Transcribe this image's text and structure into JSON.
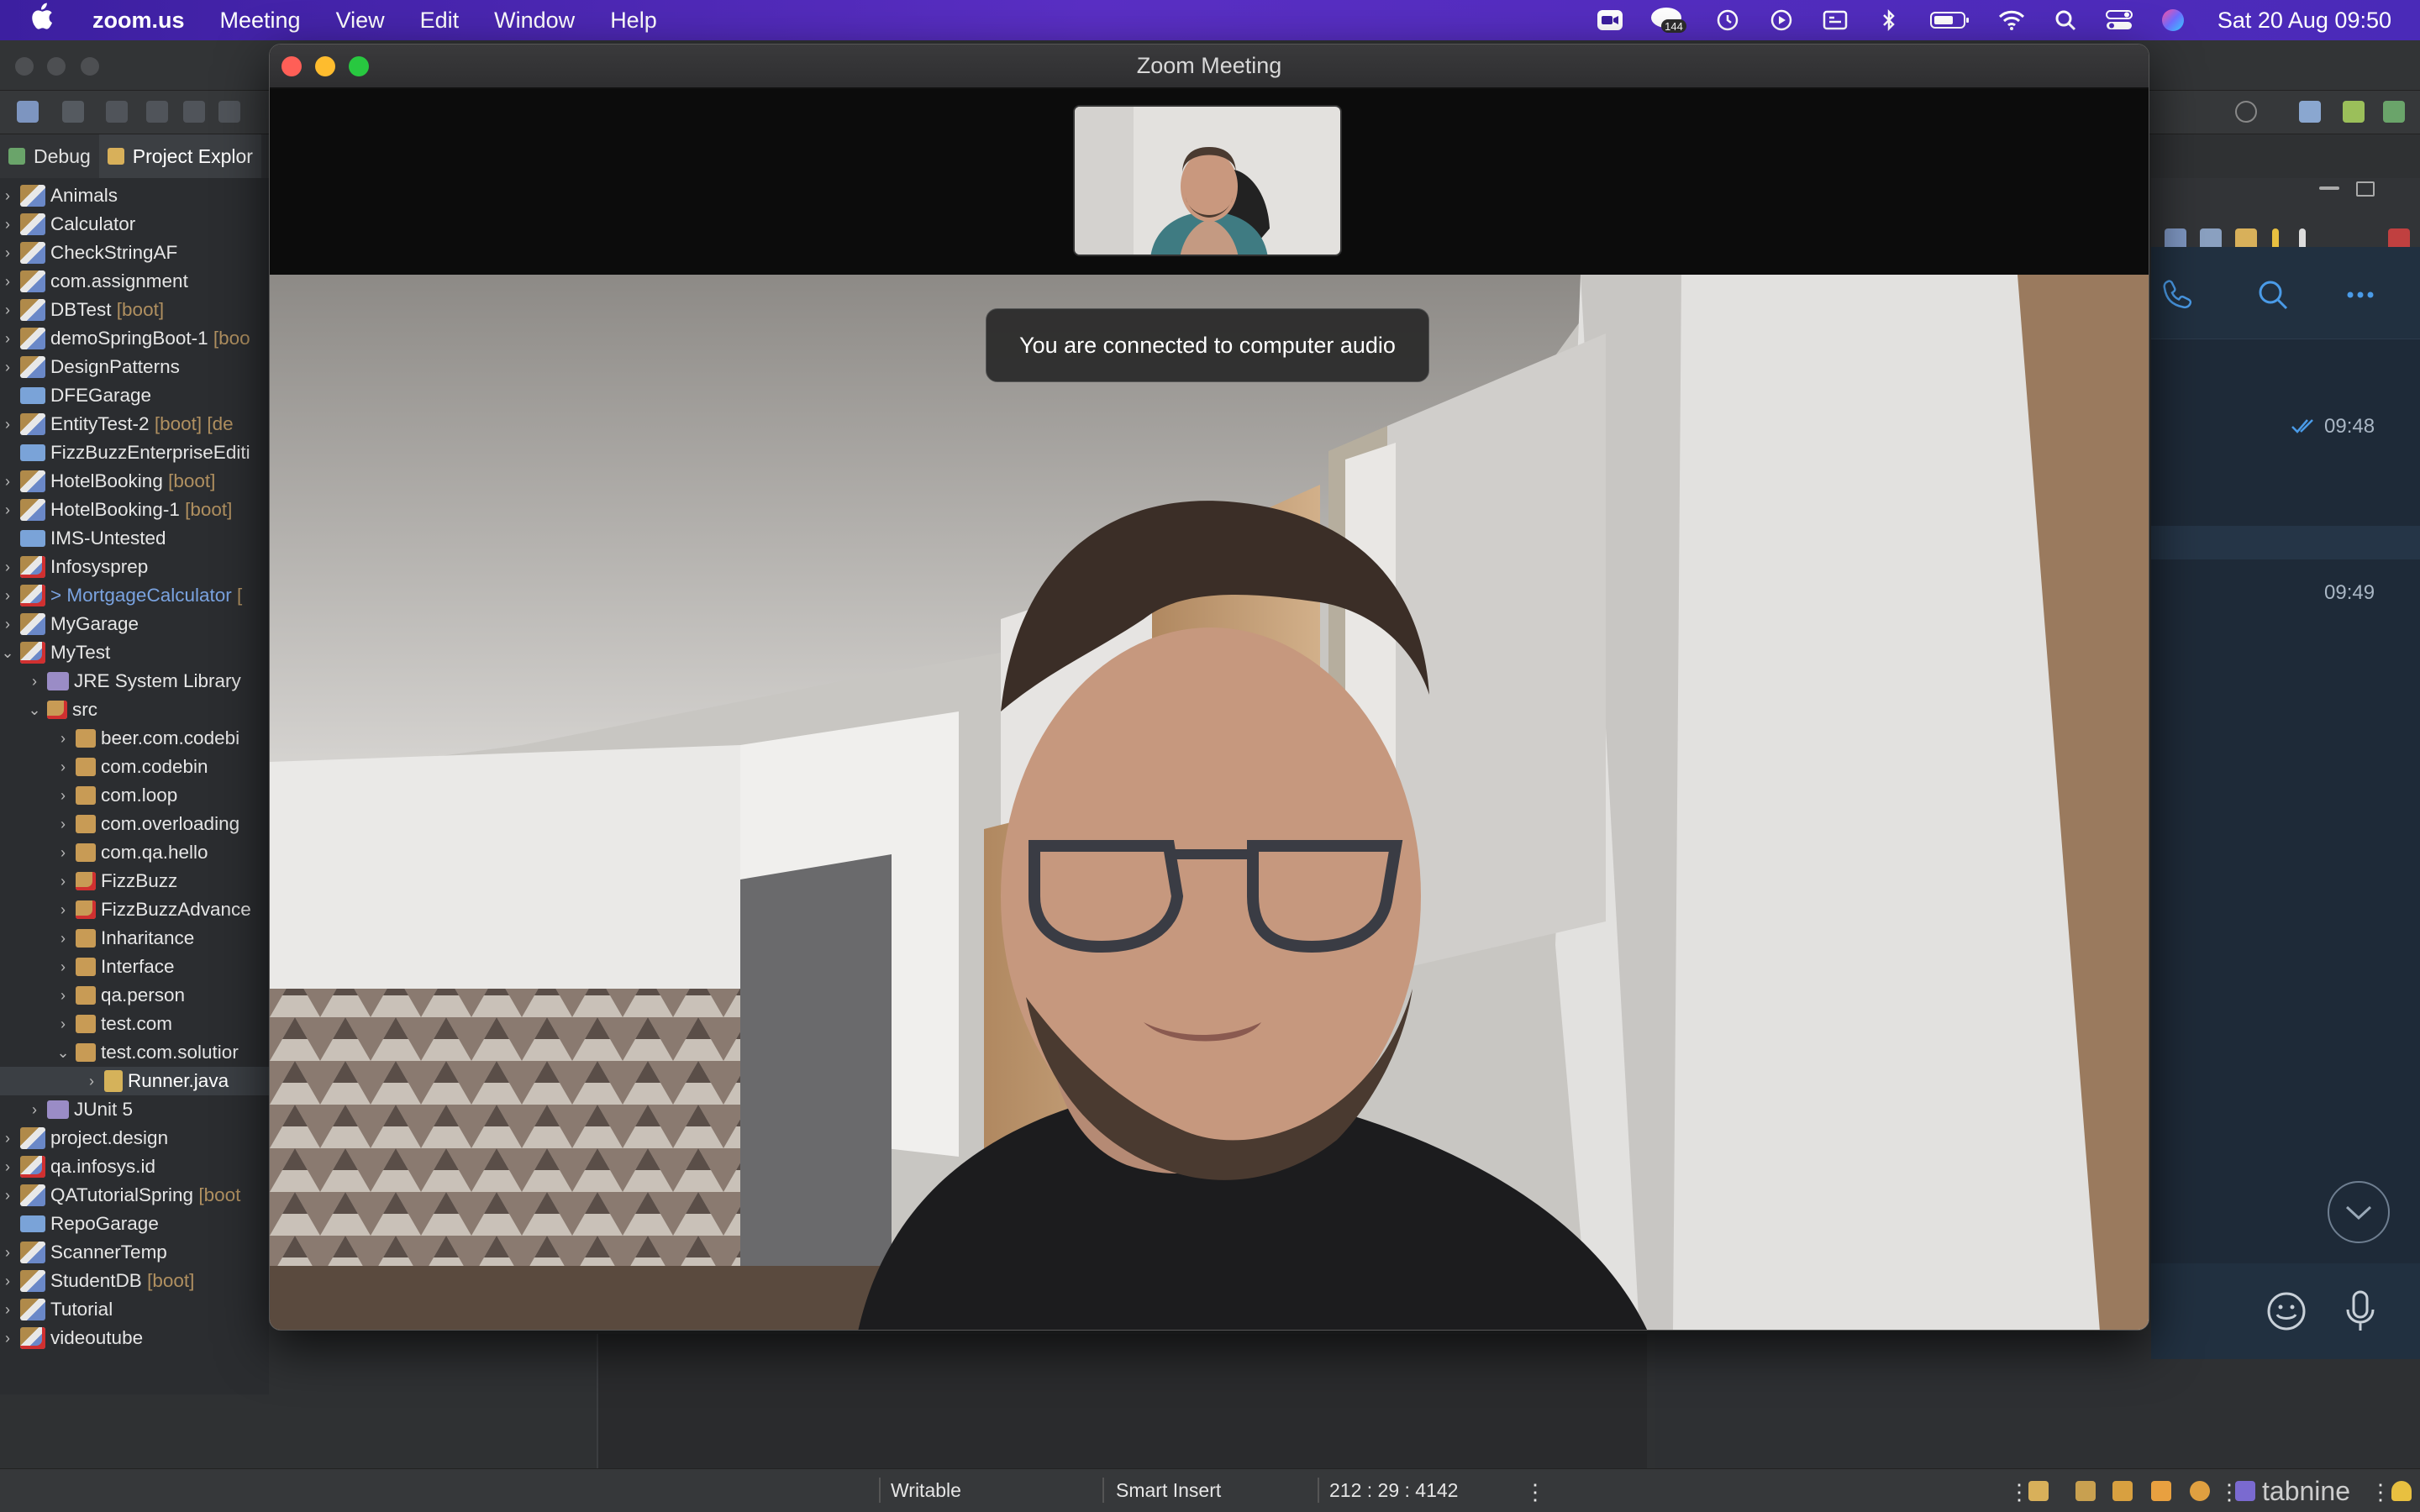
{
  "menubar": {
    "app": "zoom.us",
    "items": [
      "Meeting",
      "View",
      "Edit",
      "Window",
      "Help"
    ],
    "badge_count": "144",
    "datetime": "Sat 20 Aug  09:50"
  },
  "eclipse": {
    "tabs": {
      "debug": "Debug",
      "project_explorer": "Project Explor"
    },
    "tree": [
      {
        "label": "Animals",
        "suffix": ""
      },
      {
        "label": "Calculator",
        "suffix": ""
      },
      {
        "label": "CheckStringAF",
        "suffix": ""
      },
      {
        "label": "com.assignment",
        "suffix": ""
      },
      {
        "label": "DBTest",
        "suffix": "[boot]"
      },
      {
        "label": "demoSpringBoot-1",
        "suffix": "[boo"
      },
      {
        "label": "DesignPatterns",
        "suffix": ""
      },
      {
        "label": "DFEGarage",
        "suffix": ""
      },
      {
        "label": "EntityTest-2",
        "suffix": "[boot] [de"
      },
      {
        "label": "FizzBuzzEnterpriseEditi",
        "suffix": ""
      },
      {
        "label": "HotelBooking",
        "suffix": "[boot]"
      },
      {
        "label": "HotelBooking-1",
        "suffix": "[boot]"
      },
      {
        "label": "IMS-Untested",
        "suffix": ""
      },
      {
        "label": "Infosysprep",
        "suffix": ""
      },
      {
        "label": "> MortgageCalculator",
        "suffix": "["
      },
      {
        "label": "MyGarage",
        "suffix": ""
      },
      {
        "label": "MyTest",
        "suffix": ""
      },
      {
        "label": "JRE System Library",
        "suffix": ""
      },
      {
        "label": "src",
        "suffix": ""
      },
      {
        "label": "beer.com.codebi",
        "suffix": ""
      },
      {
        "label": "com.codebin",
        "suffix": ""
      },
      {
        "label": "com.loop",
        "suffix": ""
      },
      {
        "label": "com.overloading",
        "suffix": ""
      },
      {
        "label": "com.qa.hello",
        "suffix": ""
      },
      {
        "label": "FizzBuzz",
        "suffix": ""
      },
      {
        "label": "FizzBuzzAdvance",
        "suffix": ""
      },
      {
        "label": "Inharitance",
        "suffix": ""
      },
      {
        "label": "Interface",
        "suffix": ""
      },
      {
        "label": "qa.person",
        "suffix": ""
      },
      {
        "label": "test.com",
        "suffix": ""
      },
      {
        "label": "test.com.solutior",
        "suffix": ""
      },
      {
        "label": "Runner.java",
        "suffix": ""
      },
      {
        "label": "JUnit 5",
        "suffix": ""
      },
      {
        "label": "project.design",
        "suffix": ""
      },
      {
        "label": "qa.infosys.id",
        "suffix": ""
      },
      {
        "label": "QATutorialSpring",
        "suffix": "[boot"
      },
      {
        "label": "RepoGarage",
        "suffix": ""
      },
      {
        "label": "ScannerTemp",
        "suffix": ""
      },
      {
        "label": "StudentDB",
        "suffix": "[boot]"
      },
      {
        "label": "Tutorial",
        "suffix": ""
      },
      {
        "label": "videoutube",
        "suffix": ""
      }
    ],
    "status": {
      "writable": "Writable",
      "insert_mode": "Smart Insert",
      "position": "212 : 29 : 4142",
      "tabnine": "tabnine"
    }
  },
  "chat": {
    "time1": "09:48",
    "time2": "09:49"
  },
  "zoom": {
    "window_title": "Zoom Meeting",
    "toast": "You are connected to computer audio"
  },
  "colors": {
    "menubar": "#4a2ab8",
    "close": "#ff5f57",
    "minimize": "#febc2e",
    "zoom": "#28c840",
    "chat_accent": "#4a9be8"
  }
}
